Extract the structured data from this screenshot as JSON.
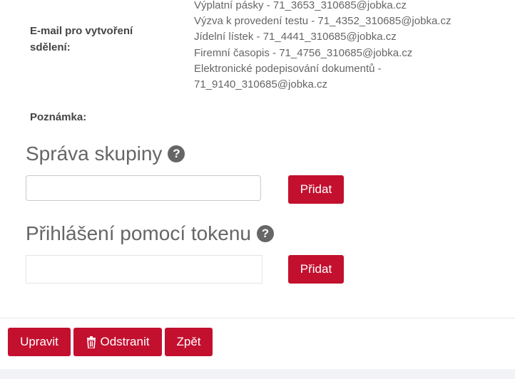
{
  "email": {
    "label": "E-mail pro vytvoření sdělení:",
    "items": [
      "Výplatní pásky - 71_3653_310685@jobka.cz",
      "Výzva k provedení testu - 71_4352_310685@jobka.cz",
      "Jídelní lístek - 71_4441_310685@jobka.cz",
      "Firemní časopis - 71_4756_310685@jobka.cz",
      "Elektronické podepisování dokumentů -",
      "71_9140_310685@jobka.cz"
    ]
  },
  "note": {
    "label": "Poznámka:"
  },
  "group_admin": {
    "title": "Správa skupiny",
    "help": "?",
    "input_value": "",
    "add_label": "Přidat"
  },
  "token_login": {
    "title": "Přihlášení pomocí tokenu",
    "help": "?",
    "input_value": "",
    "add_label": "Přidat"
  },
  "actions": {
    "edit_label": "Upravit",
    "delete_label": "Odstranit",
    "back_label": "Zpět"
  },
  "colors": {
    "primary": "#c3102f",
    "text": "#666666"
  },
  "icons": {
    "help": "question-circle-icon",
    "delete": "trash-icon"
  }
}
